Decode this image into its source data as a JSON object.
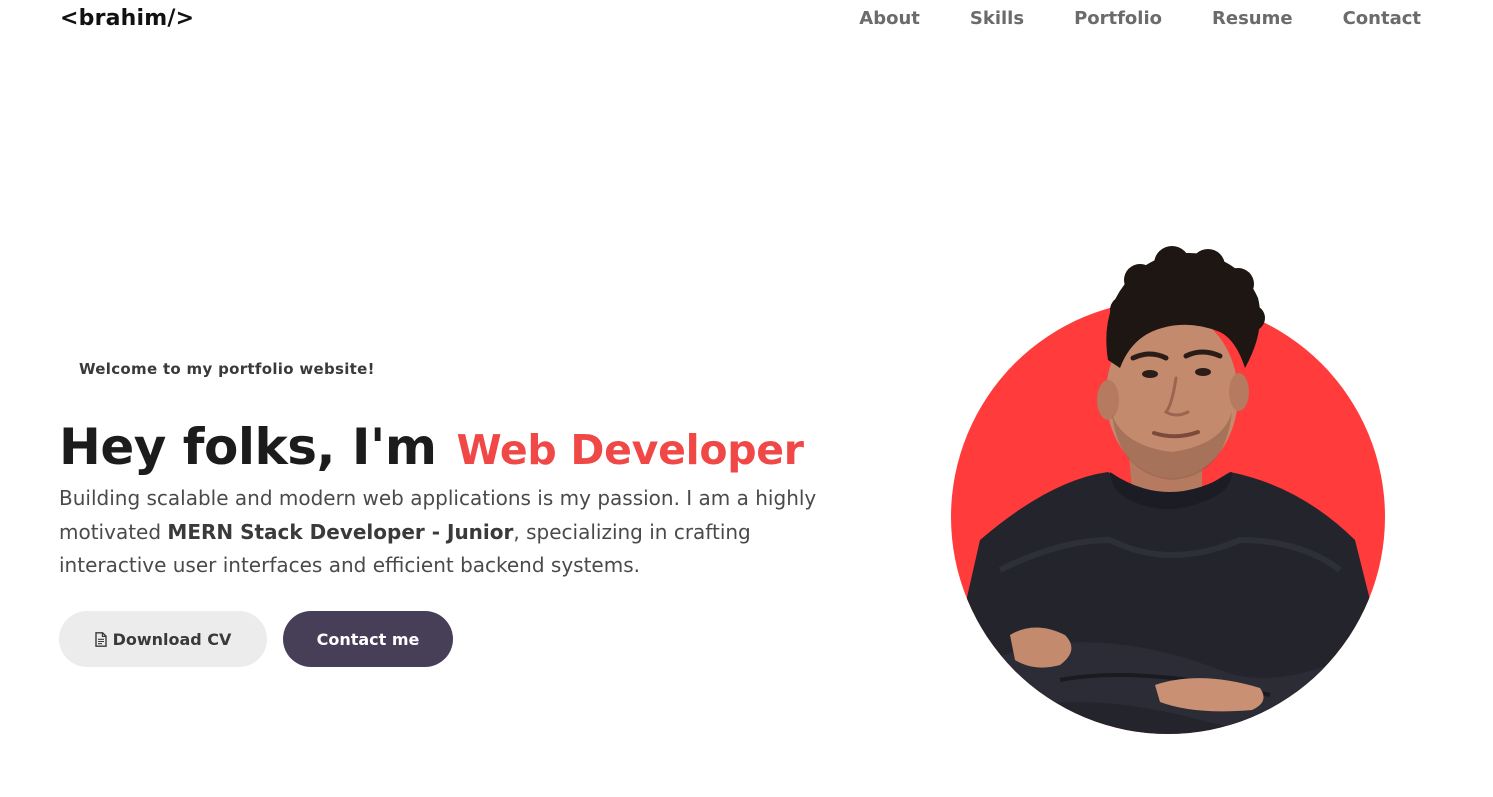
{
  "header": {
    "logo": "<brahim/>",
    "nav": [
      {
        "label": "About"
      },
      {
        "label": "Skills"
      },
      {
        "label": "Portfolio"
      },
      {
        "label": "Resume"
      },
      {
        "label": "Contact"
      }
    ]
  },
  "hero": {
    "welcome": "Welcome to my portfolio website!",
    "greeting": "Hey folks, I'm",
    "role": "Web Developer",
    "intro_part1": "Building scalable and modern web applications is my passion. I am a highly motivated ",
    "intro_bold": "MERN Stack Developer - Junior",
    "intro_part2": ", specializing in crafting interactive user interfaces and efficient backend systems.",
    "download_label": "Download CV",
    "contact_label": "Contact me",
    "download_icon": "file-icon"
  },
  "colors": {
    "accent": "#f04747",
    "circle": "#ff3b3b",
    "button_dark": "#463f57",
    "button_light": "#ececec"
  }
}
